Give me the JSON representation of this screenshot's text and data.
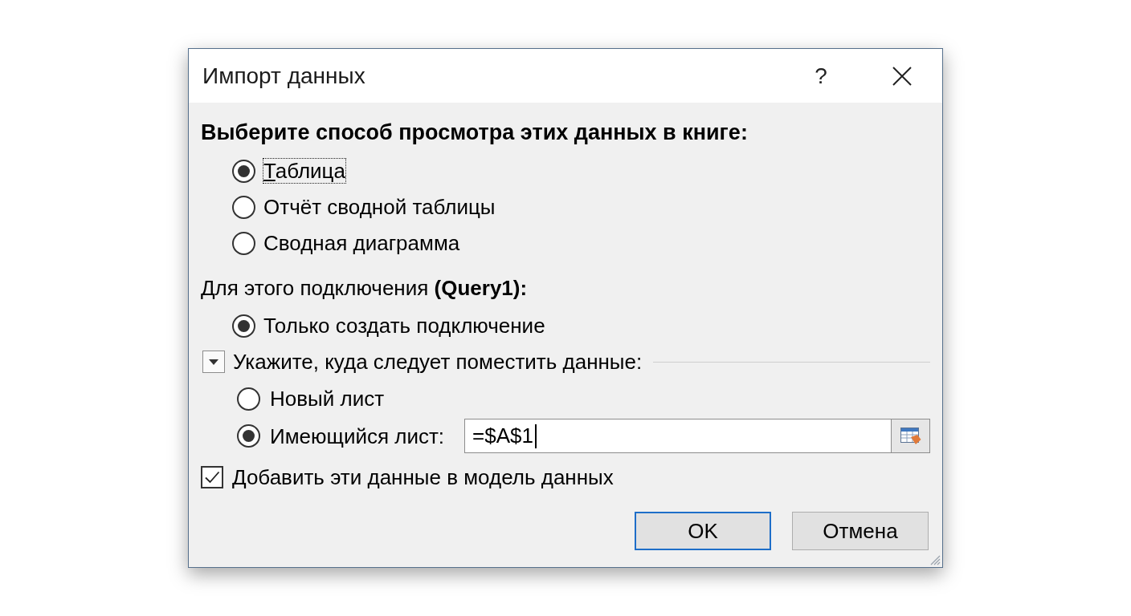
{
  "window": {
    "title": "Импорт данных",
    "help_button": "?"
  },
  "view_section": {
    "heading": "Выберите способ просмотра этих данных в книге:",
    "options": [
      {
        "label": "Таблица",
        "selected": true,
        "focused": true
      },
      {
        "label": "Отчёт сводной таблицы",
        "selected": false,
        "focused": false
      },
      {
        "label": "Сводная диаграмма",
        "selected": false,
        "focused": false
      }
    ]
  },
  "connection_section": {
    "label": "Для этого подключения **(Query1):**",
    "options": [
      {
        "label": "Только создать подключение",
        "selected": true
      }
    ]
  },
  "placement_section": {
    "label": "Укажите, куда следует поместить данные:",
    "expanded": true,
    "options": [
      {
        "label": "Новый лист",
        "selected": false
      },
      {
        "label": "Имеющийся лист:",
        "selected": true
      }
    ],
    "range_field": {
      "value": "=$A$1"
    }
  },
  "data_model_option": {
    "label": "Добавить эти данные в модель данных",
    "checked": true
  },
  "buttons": [
    {
      "label": "OK",
      "default": true
    },
    {
      "label": "Отмена",
      "default": false
    }
  ]
}
